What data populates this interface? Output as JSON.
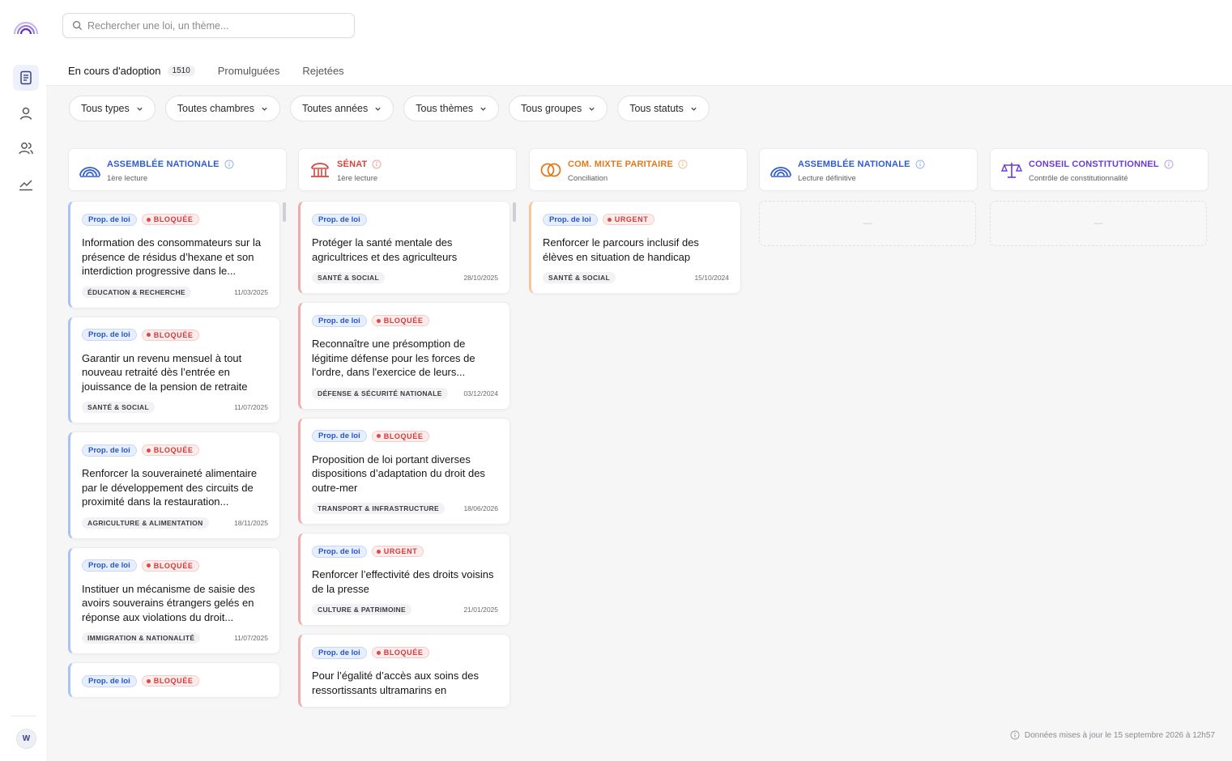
{
  "app": {
    "avatar_initial": "W"
  },
  "colors": {
    "assemblee": "#2e5bd0",
    "senat": "#d9433b",
    "cmp": "#e07a1c",
    "conseil": "#6a3bd6"
  },
  "sidebar": {
    "items": [
      {
        "icon": "document-icon",
        "active": true
      },
      {
        "icon": "person-icon",
        "active": false
      },
      {
        "icon": "people-icon",
        "active": false
      },
      {
        "icon": "chart-icon",
        "active": false
      }
    ]
  },
  "search": {
    "placeholder": "Rechercher une loi, un thème..."
  },
  "tabs": [
    {
      "label": "En cours d'adoption",
      "count": "1510",
      "active": true
    },
    {
      "label": "Promulguées"
    },
    {
      "label": "Rejetées"
    }
  ],
  "filters": [
    "Tous types",
    "Toutes chambres",
    "Toutes années",
    "Tous thèmes",
    "Tous groupes",
    "Tous statuts"
  ],
  "columns": [
    {
      "title": "ASSEMBLÉE NATIONALE",
      "subtitle": "1ère lecture",
      "icon": "assemblee-icon",
      "cards": [
        {
          "type": "Prop. de loi",
          "status": "BLOQUÉE",
          "title": "Information des consommateurs sur la présence de résidus d’hexane et son interdiction progressive dans le...",
          "theme": "ÉDUCATION & RECHERCHE",
          "date": "11/03/2025"
        },
        {
          "type": "Prop. de loi",
          "status": "BLOQUÉE",
          "title": "Garantir un revenu mensuel à tout nouveau retraité dès l’entrée en jouissance de la pension de retraite",
          "theme": "SANTÉ & SOCIAL",
          "date": "11/07/2025"
        },
        {
          "type": "Prop. de loi",
          "status": "BLOQUÉE",
          "title": "Renforcer la souveraineté alimentaire par le développement des circuits de proximité dans la restauration...",
          "theme": "AGRICULTURE & ALIMENTATION",
          "date": "18/11/2025"
        },
        {
          "type": "Prop. de loi",
          "status": "BLOQUÉE",
          "title": "Instituer un mécanisme de saisie des avoirs souverains étrangers gelés en réponse aux violations du droit...",
          "theme": "IMMIGRATION & NATIONALITÉ",
          "date": "11/07/2025"
        },
        {
          "type": "Prop. de loi",
          "status": "BLOQUÉE",
          "title": "",
          "theme": "",
          "date": ""
        }
      ]
    },
    {
      "title": "SÉNAT",
      "subtitle": "1ère lecture",
      "icon": "senat-icon",
      "cards": [
        {
          "type": "Prop. de loi",
          "status": "",
          "title": "Protéger la santé mentale des agricultrices et des agriculteurs",
          "theme": "SANTÉ & SOCIAL",
          "date": "28/10/2025"
        },
        {
          "type": "Prop. de loi",
          "status": "BLOQUÉE",
          "title": "Reconnaître une présomption de légitime défense pour les forces de l'ordre, dans l'exercice de leurs...",
          "theme": "DÉFENSE & SÉCURITÉ NATIONALE",
          "date": "03/12/2024"
        },
        {
          "type": "Prop. de loi",
          "status": "BLOQUÉE",
          "title": "Proposition de loi portant diverses dispositions d’adaptation du droit des outre-mer",
          "theme": "TRANSPORT & INFRASTRUCTURE",
          "date": "18/06/2026"
        },
        {
          "type": "Prop. de loi",
          "status": "URGENT",
          "title": "Renforcer l’effectivité des droits voisins de la presse",
          "theme": "CULTURE & PATRIMOINE",
          "date": "21/01/2025"
        },
        {
          "type": "Prop. de loi",
          "status": "BLOQUÉE",
          "title": "Pour l’égalité d’accès aux soins des ressortissants ultramarins en",
          "theme": "",
          "date": ""
        }
      ]
    },
    {
      "title": "COM. MIXTE PARITAIRE",
      "subtitle": "Conciliation",
      "icon": "cmp-icon",
      "cards": [
        {
          "type": "Prop. de loi",
          "status": "URGENT",
          "title": "Renforcer le parcours inclusif des élèves en situation de handicap",
          "theme": "SANTÉ & SOCIAL",
          "date": "15/10/2024"
        }
      ]
    },
    {
      "title": "ASSEMBLÉE NATIONALE",
      "subtitle": "Lecture définitive",
      "icon": "assemblee-icon",
      "empty": "—"
    },
    {
      "title": "CONSEIL CONSTITUTIONNEL",
      "subtitle": "Contrôle de constitutionnalité",
      "icon": "scales-icon",
      "empty": "—"
    }
  ],
  "footer": {
    "note": "Données mises à jour le 15 septembre 2026 à 12h57"
  }
}
